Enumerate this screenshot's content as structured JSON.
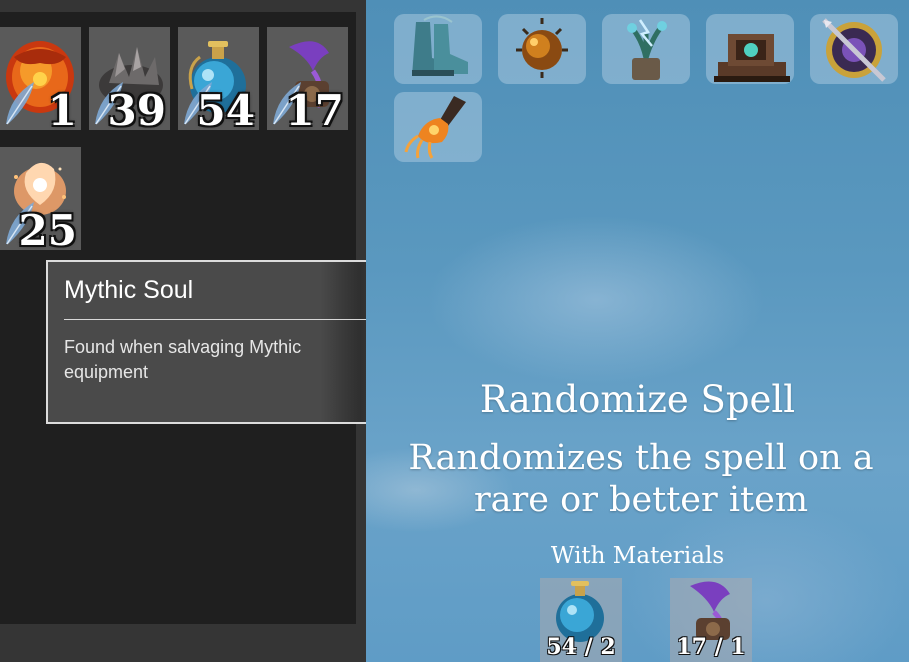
{
  "inventory": {
    "items": [
      {
        "name": "fire-orb",
        "count": "1"
      },
      {
        "name": "dark-ore",
        "count": "39"
      },
      {
        "name": "blue-potion",
        "count": "54"
      },
      {
        "name": "purple-relic",
        "count": "17"
      },
      {
        "name": "mythic-soul",
        "count": "25"
      }
    ]
  },
  "tooltip": {
    "title": "Mythic Soul",
    "description": "Found when salvaging Mythic equipment"
  },
  "recipes": [
    {
      "icon": "boots-icon"
    },
    {
      "icon": "spiked-orb-icon"
    },
    {
      "icon": "lightning-plant-icon"
    },
    {
      "icon": "forge-chest-icon"
    },
    {
      "icon": "dagger-shield-icon"
    },
    {
      "icon": "fire-gauntlet-icon"
    }
  ],
  "craft": {
    "title": "Randomize Spell",
    "description": "Randomizes the spell on a rare or better item",
    "materials_label": "With Materials",
    "materials": [
      {
        "icon": "blue-potion-icon",
        "count": "54 / 2"
      },
      {
        "icon": "purple-relic-icon",
        "count": "17 / 1"
      }
    ]
  },
  "colors": {
    "inventory_bg": "#1f1f1f",
    "slot_bg": "#5a5a5a",
    "sky": "#5a98bf",
    "tooltip_border": "#dcdcdc"
  }
}
